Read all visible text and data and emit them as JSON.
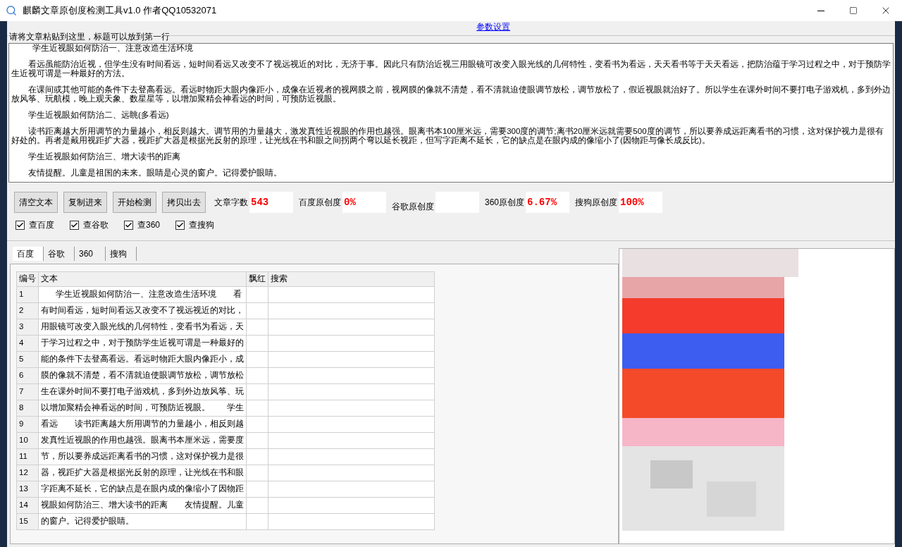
{
  "window": {
    "title": "麒麟文章原创度检测工具v1.0 作者QQ10532071"
  },
  "settings_link": "参数设置",
  "article_group": {
    "label": "请将文章粘贴到这里，标题可以放到第一行",
    "paragraphs": [
      "学生近视眼如何防治一、注意改造生活环境",
      "看远虽能防治近视，但学生没有时间看远，短时间看远又改变不了视远视近的对比，无济于事。因此只有防治近视三用眼镜可改变入眼光线的几何特性，变看书为看远，天天看书等于天天看远，把防治蕴于学习过程之中，对于预防学生近视可谓是一种最好的方法。",
      "在课间或其他可能的条件下去登高看远。看远时物距大眼内像距小，成像在近视者的视网膜之前，视网膜的像就不清楚，看不清就迫使眼调节放松，调节放松了，假近视眼就治好了。所以学生在课外时间不要打电子游戏机，多到外边放风筝、玩航模，晚上观天象、数星星等，以增加聚精会神看远的时间，可预防近视眼。",
      "学生近视眼如何防治二、远眺(多看远)",
      "读书距离越大所用调节的力量越小，相反则越大。调节用的力量越大，激发真性近视眼的作用也越强。眼离书本100厘米远，需要300度的调节;离书20厘米远就需要500度的调节，所以要养成远距离看书的习惯，这对保护视力是很有好处的。再者是戴用视距扩大器，视距扩大器是根据光反射的原理，让光线在书和眼之间拐两个弯以延长视距，但写字距离不延长，它的缺点是在眼内成的像缩小了(因物距与像长成反比)。",
      "学生近视眼如何防治三、增大读书的距离",
      "友情提醒。儿童是祖国的未来。眼睛是心灵的窗户。记得爱护眼睛。"
    ]
  },
  "buttons": [
    "清空文本",
    "复制进来",
    "开始检测",
    "拷贝出去"
  ],
  "stats": [
    {
      "label": "文章字数",
      "value": "543"
    },
    {
      "label": "百度原创度",
      "value": "0%"
    },
    {
      "label": "谷歌原创度"
    },
    {
      "label": "360原创度",
      "value": "6.67%"
    },
    {
      "label": "搜狗原创度",
      "value": "100%"
    }
  ],
  "checkboxes": [
    {
      "label": "查百度",
      "checked": true
    },
    {
      "label": "查谷歌",
      "checked": true
    },
    {
      "label": "查360",
      "checked": true
    },
    {
      "label": "查搜狗",
      "checked": true
    }
  ],
  "tabs": [
    {
      "label": "百度",
      "selected": true
    },
    {
      "label": "谷歌",
      "selected": false
    },
    {
      "label": "360",
      "selected": false
    },
    {
      "label": "搜狗",
      "selected": false
    }
  ],
  "table": {
    "columns": [
      "编号",
      "文本",
      "飘红",
      "搜索"
    ],
    "rows": [
      [
        "1",
        "学生近视眼如何防治一、注意改造生活环境　　看"
      ],
      [
        "2",
        "有时间看远，短时间看远又改变不了视远视近的对比，"
      ],
      [
        "3",
        "用眼镜可改变入眼光线的几何特性，变看书为看远，天"
      ],
      [
        "4",
        "于学习过程之中，对于预防学生近视可谓是一种最好的"
      ],
      [
        "5",
        "能的条件下去登高看远。看远时物距大眼内像距小，成"
      ],
      [
        "6",
        "膜的像就不清楚，看不清就迫使眼调节放松，调节放松"
      ],
      [
        "7",
        "生在课外时间不要打电子游戏机，多到外边放风筝、玩"
      ],
      [
        "8",
        "以增加聚精会神看远的时间，可预防近视眼。　　学生"
      ],
      [
        "9",
        "看远　　读书距离越大所用调节的力量越小，相反则越"
      ],
      [
        "10",
        "发真性近视眼的作用也越强。眼离书本厘米远，需要度"
      ],
      [
        "11",
        "节，所以要养成远距离看书的习惯，这对保护视力是很"
      ],
      [
        "12",
        "器，视距扩大器是根据光反射的原理，让光线在书和眼"
      ],
      [
        "13",
        "字距离不延长，它的缺点是在眼内成的像缩小了因物距"
      ],
      [
        "14",
        "视眼如何防治三、增大读书的距离　　友情提醒。儿童"
      ],
      [
        "15",
        "的窗户。记得爱护眼睛。"
      ]
    ]
  },
  "preview": {
    "kind": "picture"
  }
}
